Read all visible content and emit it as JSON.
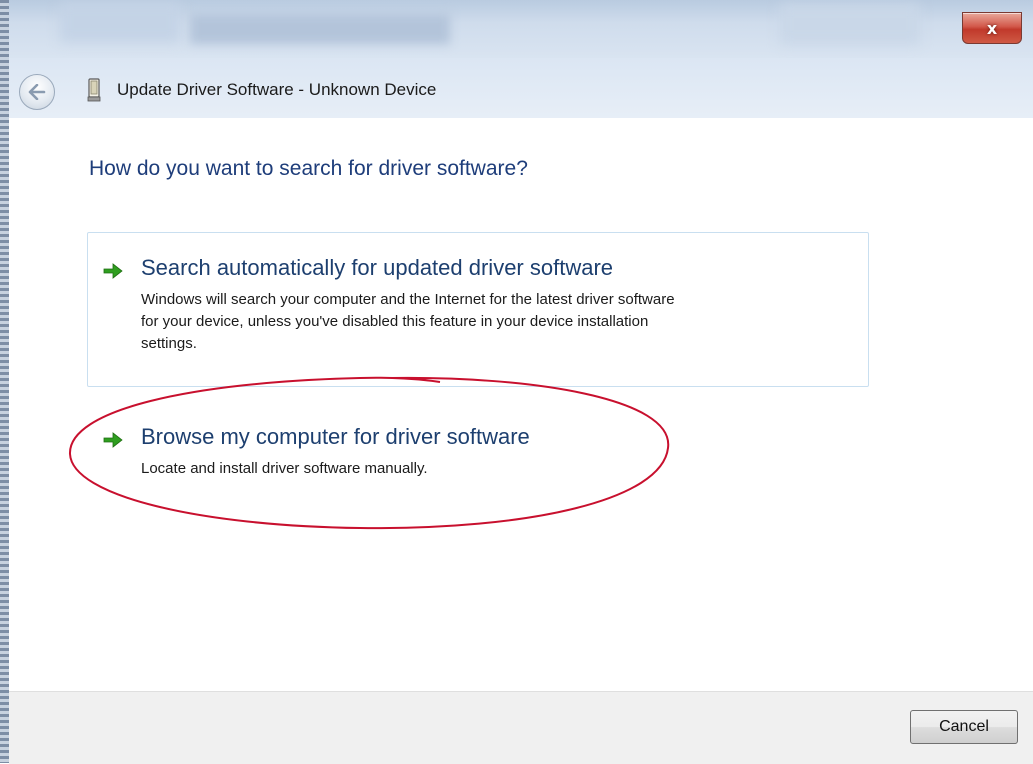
{
  "window": {
    "title": "Update Driver Software - Unknown Device",
    "close_label": "x"
  },
  "icons": {
    "back": "back-arrow-icon",
    "device": "device-icon",
    "option_arrow": "green-arrow-icon"
  },
  "main": {
    "heading": "How do you want to search for driver software?",
    "options": [
      {
        "title": "Search automatically for updated driver software",
        "description_lines": [
          "Windows will search your computer and the Internet for the latest driver software",
          "for your device, unless you've disabled this feature in your device installation",
          "settings."
        ]
      },
      {
        "title": "Browse my computer for driver software",
        "description_lines": [
          "Locate and install driver software manually."
        ]
      }
    ]
  },
  "footer": {
    "cancel_label": "Cancel"
  },
  "colors": {
    "heading": "#1e3d7a",
    "option_title": "#1d3f6f",
    "arrow_green": "#2f9e1f",
    "annotation_red": "#c8102e",
    "close_red": "#c1392b"
  }
}
